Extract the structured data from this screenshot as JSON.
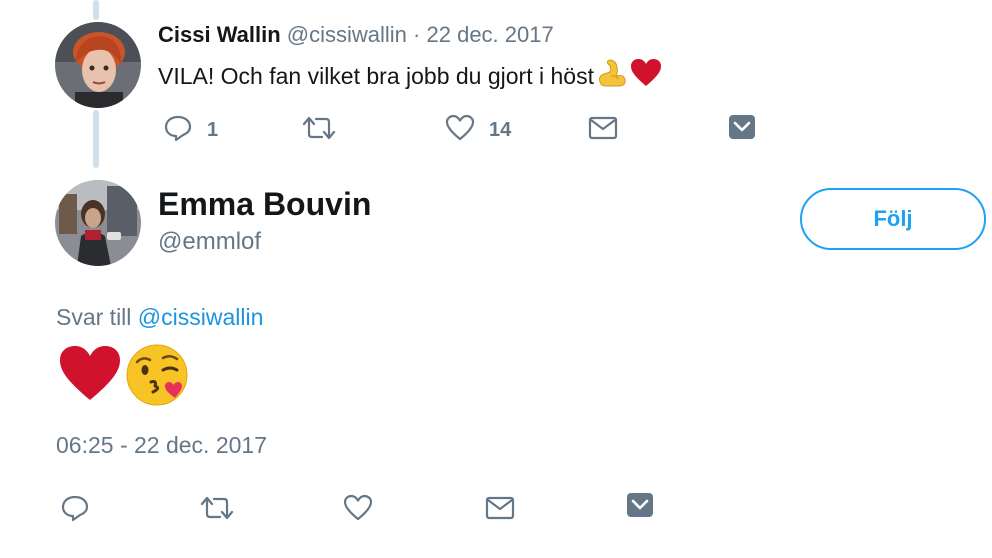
{
  "reply_tweet": {
    "name": "Cissi Wallin",
    "handle": "@cissiwallin",
    "separator": "·",
    "date": "22 dec. 2017",
    "text": "VILA! Och fan vilket bra jobb du gjort i höst",
    "emojis": [
      "flexed-biceps",
      "red-heart"
    ],
    "reply_count": "1",
    "like_count": "14"
  },
  "main_tweet": {
    "name": "Emma Bouvin",
    "handle": "@emmlof",
    "follow_label": "Följ",
    "reply_prefix": "Svar till",
    "reply_mention": "@cissiwallin",
    "emojis": [
      "red-heart",
      "face-blowing-a-kiss"
    ],
    "timestamp": "06:25 - 22 dec. 2017"
  },
  "colors": {
    "accent": "#1da1f2",
    "mention": "#1b95e0",
    "muted": "#657786",
    "text": "#14171a",
    "heart": "#d0122d",
    "thread_line": "#cfe0ee"
  }
}
